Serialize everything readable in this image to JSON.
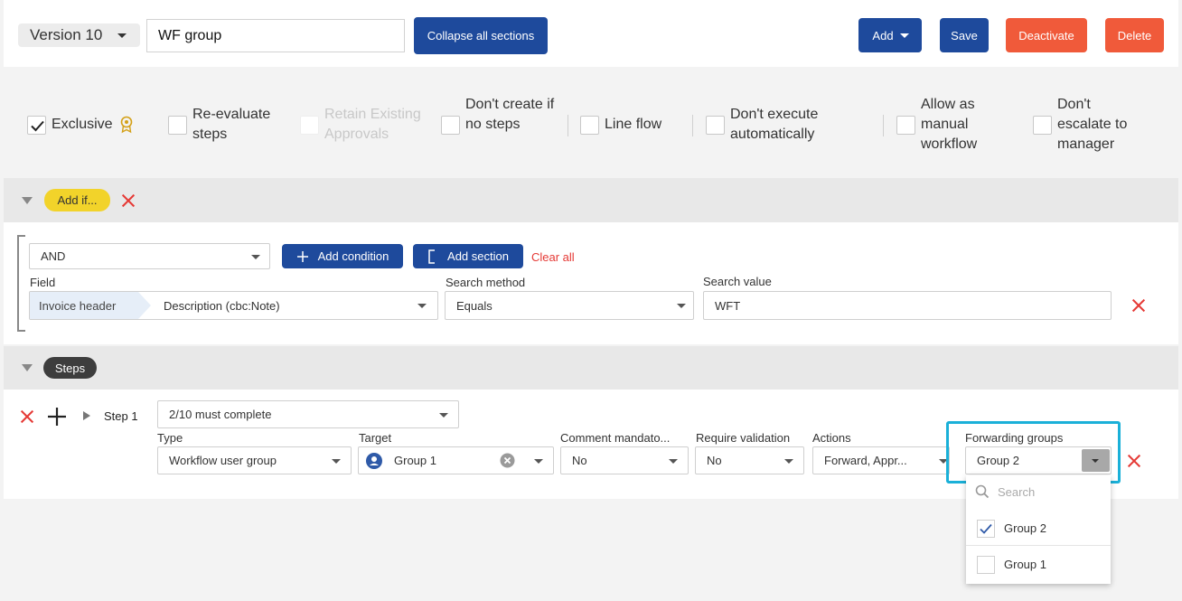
{
  "header": {
    "version_label": "Version 10",
    "workflow_name": "WF group",
    "collapse_label": "Collapse all sections",
    "add_label": "Add",
    "save_label": "Save",
    "deactivate_label": "Deactivate",
    "delete_label": "Delete"
  },
  "options": {
    "exclusive": "Exclusive",
    "reevaluate": "Re-evaluate steps",
    "retain": "Retain Existing Approvals",
    "dont_create": "Don't create if no steps",
    "line_flow": "Line flow",
    "dont_execute": "Don't execute automatically",
    "allow_manual": "Allow as manual workflow",
    "dont_escalate": "Don't escalate to manager"
  },
  "add_if": {
    "badge": "Add if...",
    "operator": "AND",
    "add_condition": "Add condition",
    "add_section": "Add section",
    "clear_all": "Clear all",
    "field_label": "Field",
    "field_group": "Invoice header",
    "field_value": "Description (cbc:Note)",
    "method_label": "Search method",
    "method_value": "Equals",
    "search_label": "Search value",
    "search_value": "WFT"
  },
  "steps": {
    "badge": "Steps",
    "step_label": "Step 1",
    "complete_rule": "2/10 must complete",
    "type_label": "Type",
    "type_value": "Workflow user group",
    "target_label": "Target",
    "target_value": "Group 1",
    "comment_label": "Comment mandato...",
    "comment_value": "No",
    "validation_label": "Require validation",
    "validation_value": "No",
    "actions_label": "Actions",
    "actions_value": "Forward, Appr...",
    "forwarding_label": "Forwarding groups",
    "forwarding_value": "Group 2",
    "dropdown": {
      "search_placeholder": "Search",
      "items": [
        {
          "label": "Group 2",
          "checked": true
        },
        {
          "label": "Group 1",
          "checked": false
        }
      ]
    }
  },
  "colors": {
    "primary": "#1e4a9c",
    "danger": "#f05a3a",
    "highlight": "#1ab0d8",
    "badge_yellow": "#f2d32a"
  }
}
